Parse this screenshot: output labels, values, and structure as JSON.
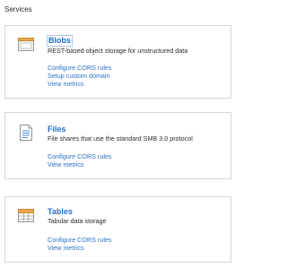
{
  "section_title": "Services",
  "colors": {
    "title": "#1f6fd1",
    "link": "#2b72c9",
    "border": "#d6d6d6"
  },
  "services": [
    {
      "title": "Blobs",
      "description": "REST-based object storage for unstructured data",
      "icon": "blob-storage-icon",
      "links": [
        "Configure CORS rules",
        "Setup custom domain",
        "View metrics"
      ]
    },
    {
      "title": "Files",
      "description": "File shares that use the standard SMB 3.0 protocol",
      "icon": "file-storage-icon",
      "links": [
        "Configure CORS rules",
        "View metrics"
      ]
    },
    {
      "title": "Tables",
      "description": "Tabular data storage",
      "icon": "table-storage-icon",
      "links": [
        "Configure CORS rules",
        "View metrics"
      ]
    }
  ]
}
